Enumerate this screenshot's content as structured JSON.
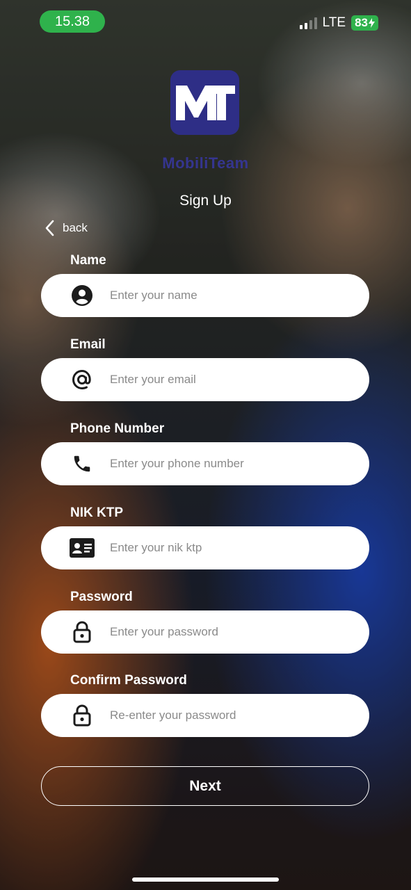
{
  "status_bar": {
    "time": "15.38",
    "network": "LTE",
    "battery": "83",
    "battery_icon": "charging-bolt-icon",
    "signal_icon": "cellular-signal-icon"
  },
  "brand": {
    "logo_letters": "MT",
    "name": "MobiliTeam",
    "logo_color": "#2e2e86"
  },
  "page": {
    "title": "Sign Up",
    "back_label": "back"
  },
  "form": {
    "fields": [
      {
        "label": "Name",
        "placeholder": "Enter your name",
        "icon": "person-icon",
        "value": ""
      },
      {
        "label": "Email",
        "placeholder": "Enter your email",
        "icon": "at-sign-icon",
        "value": ""
      },
      {
        "label": "Phone Number",
        "placeholder": "Enter your phone number",
        "icon": "phone-icon",
        "value": ""
      },
      {
        "label": "NIK KTP",
        "placeholder": "Enter your nik ktp",
        "icon": "id-card-icon",
        "value": ""
      },
      {
        "label": "Password",
        "placeholder": "Enter your password",
        "icon": "lock-icon",
        "value": ""
      },
      {
        "label": "Confirm Password",
        "placeholder": "Re-enter your password",
        "icon": "lock-icon",
        "value": ""
      }
    ],
    "submit_label": "Next"
  },
  "colors": {
    "accent_green": "#2fb24c",
    "input_bg": "#ffffff",
    "icon_color": "#1c1c1c"
  }
}
